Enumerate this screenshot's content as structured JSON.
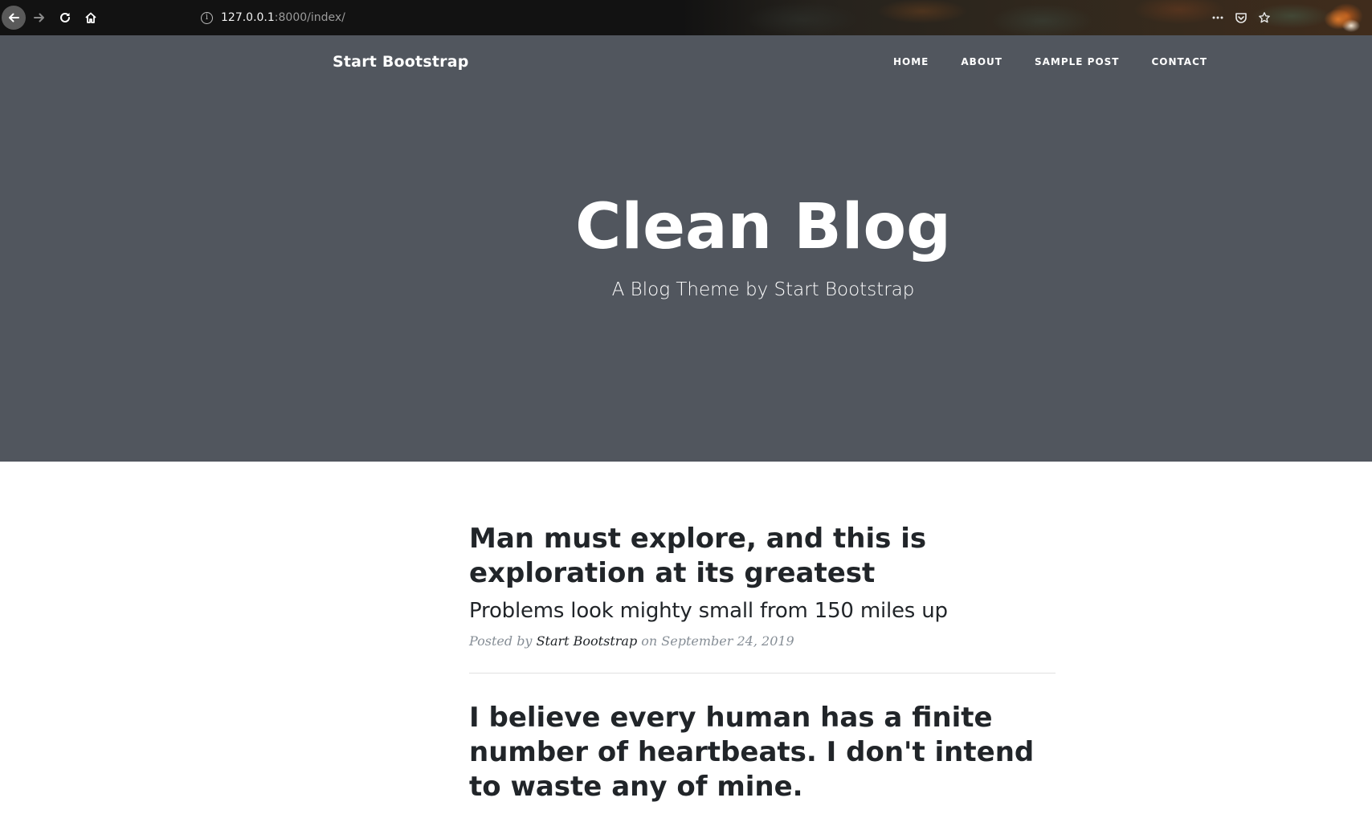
{
  "browser": {
    "url_host": "127.0.0.1",
    "url_rest": ":8000/index/",
    "icons": {
      "back": "arrow-left-icon",
      "forward": "arrow-right-icon",
      "reload": "reload-icon",
      "home": "home-icon",
      "info": "info-icon",
      "more": "more-icon",
      "pocket": "pocket-icon",
      "bookmark": "star-icon"
    }
  },
  "site": {
    "brand": "Start Bootstrap",
    "nav": [
      "HOME",
      "ABOUT",
      "SAMPLE POST",
      "CONTACT"
    ]
  },
  "hero": {
    "title": "Clean Blog",
    "subtitle": "A Blog Theme by Start Bootstrap"
  },
  "posts": [
    {
      "title": "Man must explore, and this is exploration at its greatest",
      "subtitle": "Problems look mighty small from 150 miles up",
      "meta_prefix": "Posted by ",
      "author": "Start Bootstrap",
      "meta_suffix": " on September 24, 2019"
    },
    {
      "title": "I believe every human has a finite number of heartbeats. I don't intend to waste any of mine."
    }
  ],
  "colors": {
    "browser_bar": "#121212",
    "masthead": "#51565e",
    "text_dark": "#212529",
    "meta_gray": "#868e96"
  }
}
